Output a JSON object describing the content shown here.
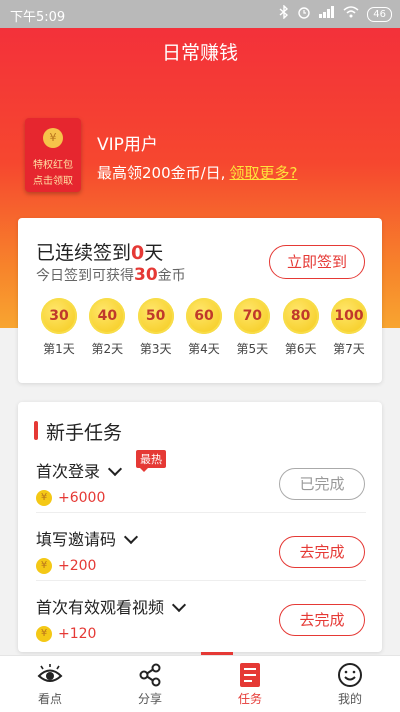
{
  "status_bar": {
    "time": "下午5:09",
    "battery": "46"
  },
  "header": {
    "title": "日常赚钱"
  },
  "vip": {
    "packet_label": "特权红包",
    "packet_action": "点击领取",
    "coin_symbol": "¥",
    "title": "VIP用户",
    "desc": "最高领200金币/日,",
    "link": "领取更多?"
  },
  "checkin": {
    "title_prefix": "已连续签到",
    "streak": "0",
    "title_suffix": "天",
    "sub_prefix": "今日签到可获得",
    "reward": "30",
    "sub_suffix": "金币",
    "button": "立即签到",
    "days": [
      {
        "coins": "30",
        "label": "第1天"
      },
      {
        "coins": "40",
        "label": "第2天"
      },
      {
        "coins": "50",
        "label": "第3天"
      },
      {
        "coins": "60",
        "label": "第4天"
      },
      {
        "coins": "70",
        "label": "第5天"
      },
      {
        "coins": "80",
        "label": "第6天"
      },
      {
        "coins": "100",
        "label": "第7天"
      }
    ]
  },
  "tasks": {
    "heading": "新手任务",
    "items": [
      {
        "name": "首次登录",
        "badge": "最热",
        "reward": "+6000",
        "button": "已完成"
      },
      {
        "name": "填写邀请码",
        "reward": "+200",
        "button": "去完成"
      },
      {
        "name": "首次有效观看视频",
        "reward": "+120",
        "button": "去完成"
      }
    ]
  },
  "tabbar": {
    "items": [
      {
        "label": "看点",
        "icon": "eye-icon"
      },
      {
        "label": "分享",
        "icon": "share-icon"
      },
      {
        "label": "任务",
        "icon": "task-icon",
        "active": true
      },
      {
        "label": "我的",
        "icon": "smile-icon"
      }
    ]
  },
  "colors": {
    "accent": "#e53935",
    "coin": "#f4c816",
    "hero_top": "#f3313a",
    "hero_bottom": "#f8a530"
  }
}
